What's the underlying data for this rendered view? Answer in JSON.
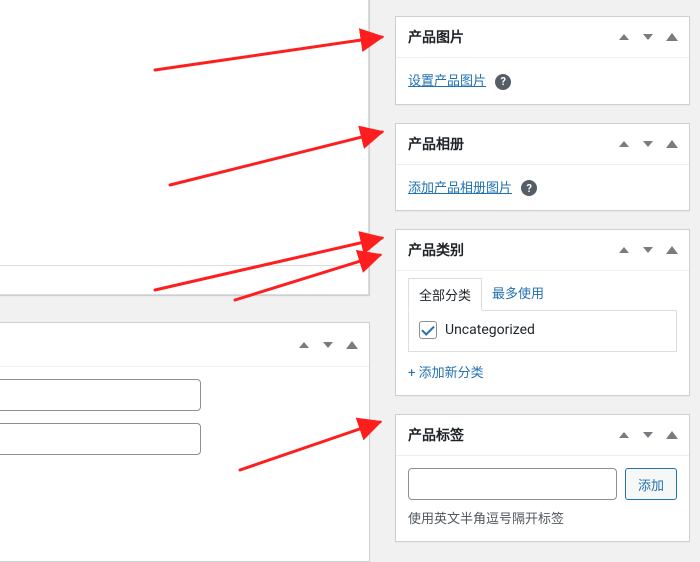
{
  "panels": {
    "image": {
      "title": "产品图片",
      "link": "设置产品图片"
    },
    "gallery": {
      "title": "产品相册",
      "link": "添加产品相册图片"
    },
    "category": {
      "title": "产品类别",
      "tabs": {
        "all": "全部分类",
        "popular": "最多使用"
      },
      "items": [
        {
          "label": "Uncategorized",
          "checked": true
        }
      ],
      "add_new": "+ 添加新分类"
    },
    "tags": {
      "title": "产品标签",
      "add_btn": "添加",
      "hint": "使用英文半角逗号隔开标签"
    }
  },
  "help_icon": "?"
}
